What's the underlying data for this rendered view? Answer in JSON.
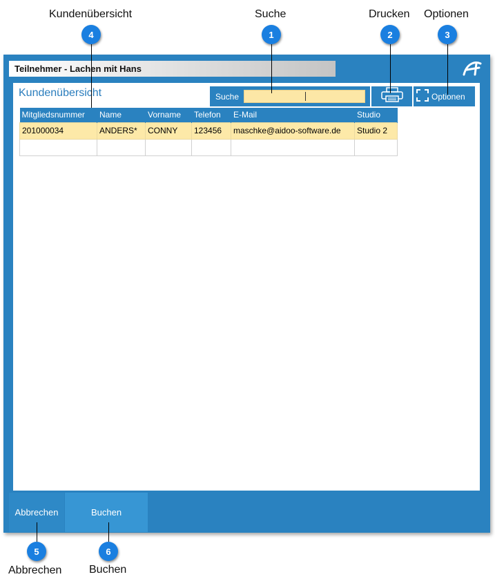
{
  "callouts": {
    "overview": {
      "label": "Kundenübersicht",
      "number": "4"
    },
    "search": {
      "label": "Suche",
      "number": "1"
    },
    "print": {
      "label": "Drucken",
      "number": "2"
    },
    "options": {
      "label": "Optionen",
      "number": "3"
    },
    "cancel": {
      "label": "Abbrechen",
      "number": "5"
    },
    "book": {
      "label": "Buchen",
      "number": "6"
    }
  },
  "window": {
    "title": "Teilnehmer - Lachen mit Hans",
    "logo_icon": "aidoo-logo-icon"
  },
  "panel": {
    "title": "Kundenübersicht"
  },
  "search": {
    "label": "Suche",
    "value": ""
  },
  "toolbar": {
    "print_icon": "printer-icon",
    "options_icon": "expand-icon",
    "options_label": "Optionen"
  },
  "table": {
    "columns": [
      "Mitgliedsnummer",
      "Name",
      "Vorname",
      "Telefon",
      "E-Mail",
      "Studio"
    ],
    "rows": [
      [
        "201000034",
        "ANDERS*",
        "CONNY",
        "123456",
        "maschke@aidoo-software.de",
        "Studio 2"
      ]
    ]
  },
  "footer": {
    "cancel_label": "Abbrechen",
    "book_label": "Buchen"
  },
  "colors": {
    "accent": "#2a82c0",
    "selected_row": "#fde9a8",
    "badge": "#1a7fe0"
  }
}
